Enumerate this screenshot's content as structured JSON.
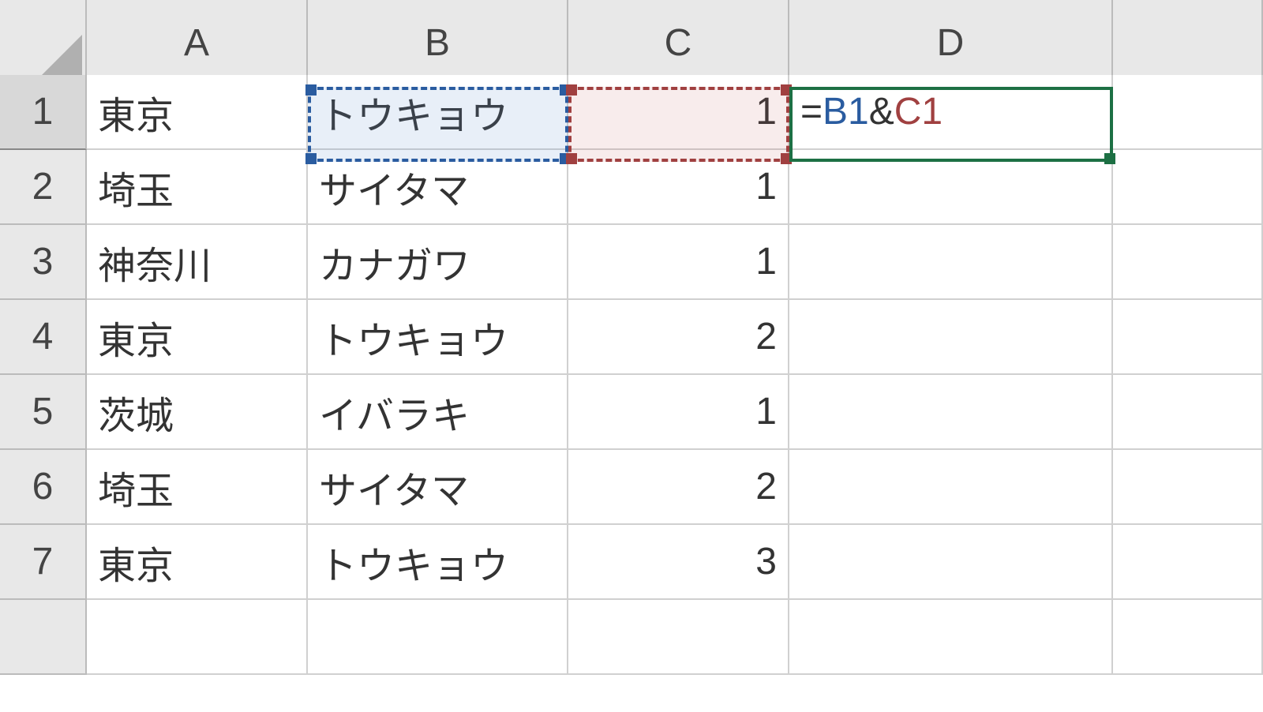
{
  "columns": [
    "A",
    "B",
    "C",
    "D"
  ],
  "row_numbers": [
    "1",
    "2",
    "3",
    "4",
    "5",
    "6",
    "7"
  ],
  "rows": [
    {
      "A": "東京",
      "B": "トウキョウ",
      "C": "1",
      "D": ""
    },
    {
      "A": "埼玉",
      "B": "サイタマ",
      "C": "1",
      "D": ""
    },
    {
      "A": "神奈川",
      "B": "カナガワ",
      "C": "1",
      "D": ""
    },
    {
      "A": "東京",
      "B": "トウキョウ",
      "C": "2",
      "D": ""
    },
    {
      "A": "茨城",
      "B": "イバラキ",
      "C": "1",
      "D": ""
    },
    {
      "A": "埼玉",
      "B": "サイタマ",
      "C": "2",
      "D": ""
    },
    {
      "A": "東京",
      "B": "トウキョウ",
      "C": "3",
      "D": ""
    }
  ],
  "active_cell": {
    "address": "D1",
    "formula_parts": {
      "eq": "=",
      "ref1": "B1",
      "op": "&",
      "ref2": "C1"
    }
  },
  "references": [
    {
      "range": "B1",
      "color": "blue"
    },
    {
      "range": "C1",
      "color": "red"
    }
  ]
}
